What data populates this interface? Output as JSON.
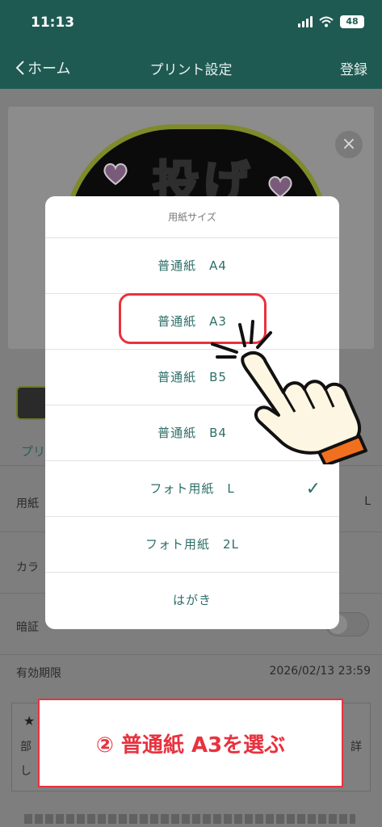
{
  "status_bar": {
    "time": "11:13",
    "battery": "48"
  },
  "nav": {
    "back_label": "ホーム",
    "title": "プリント設定",
    "action": "登録"
  },
  "preview": {
    "art_text": "投げ",
    "close_icon": "×"
  },
  "settings": {
    "print_tab": "プリ",
    "paper_label": "用紙",
    "paper_value_fragment": "L",
    "color_label": "カラ",
    "pin_label": "暗証",
    "expiry_label": "有効期限",
    "expiry_value": "2026/02/13 23:59",
    "note_star": "★",
    "note_line1_start": "部",
    "note_line1_end": "詳",
    "note_line2_start": "し"
  },
  "modal": {
    "title": "用紙サイズ",
    "options": [
      {
        "name": "普通紙",
        "size": "A4",
        "selected": false
      },
      {
        "name": "普通紙",
        "size": "A3",
        "selected": false
      },
      {
        "name": "普通紙",
        "size": "B5",
        "selected": false
      },
      {
        "name": "普通紙",
        "size": "B4",
        "selected": false
      },
      {
        "name": "フォト用紙",
        "size": "L",
        "selected": true
      },
      {
        "name": "フォト用紙",
        "size": "2L",
        "selected": false
      },
      {
        "name": "はがき",
        "size": "",
        "selected": false
      }
    ],
    "check_glyph": "✓"
  },
  "annotation": {
    "callout_text": "② 普通紙 A3を選ぶ",
    "accent_color": "#e8323f"
  },
  "colors": {
    "header_bg": "#1e5a52",
    "option_text": "#2e6e68"
  }
}
